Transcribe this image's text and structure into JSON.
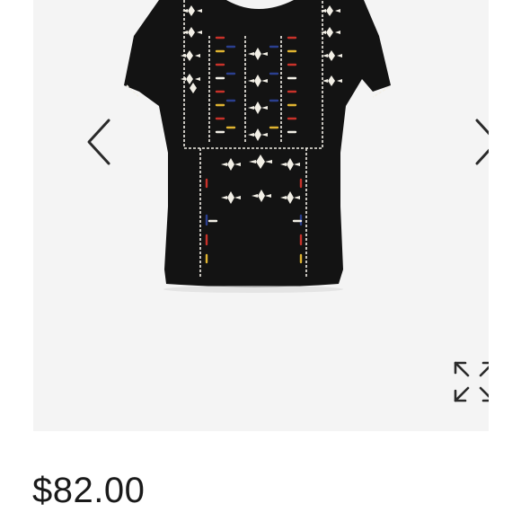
{
  "product": {
    "price": "$82.00"
  },
  "gallery": {
    "image_name": "embroidered-black-top",
    "prev_icon": "chevron-left-icon",
    "next_icon": "chevron-right-icon",
    "expand_icon": "expand-arrows-icon"
  },
  "colors": {
    "gallery_background": "#f4f4f4",
    "garment": "#131313",
    "embroidery_white": "#f2efe6",
    "embroidery_red": "#c8322a",
    "embroidery_blue": "#2b3f8f",
    "embroidery_yellow": "#e0b431",
    "icon": "#2a2a2a",
    "price_text": "#1a1a1a"
  }
}
